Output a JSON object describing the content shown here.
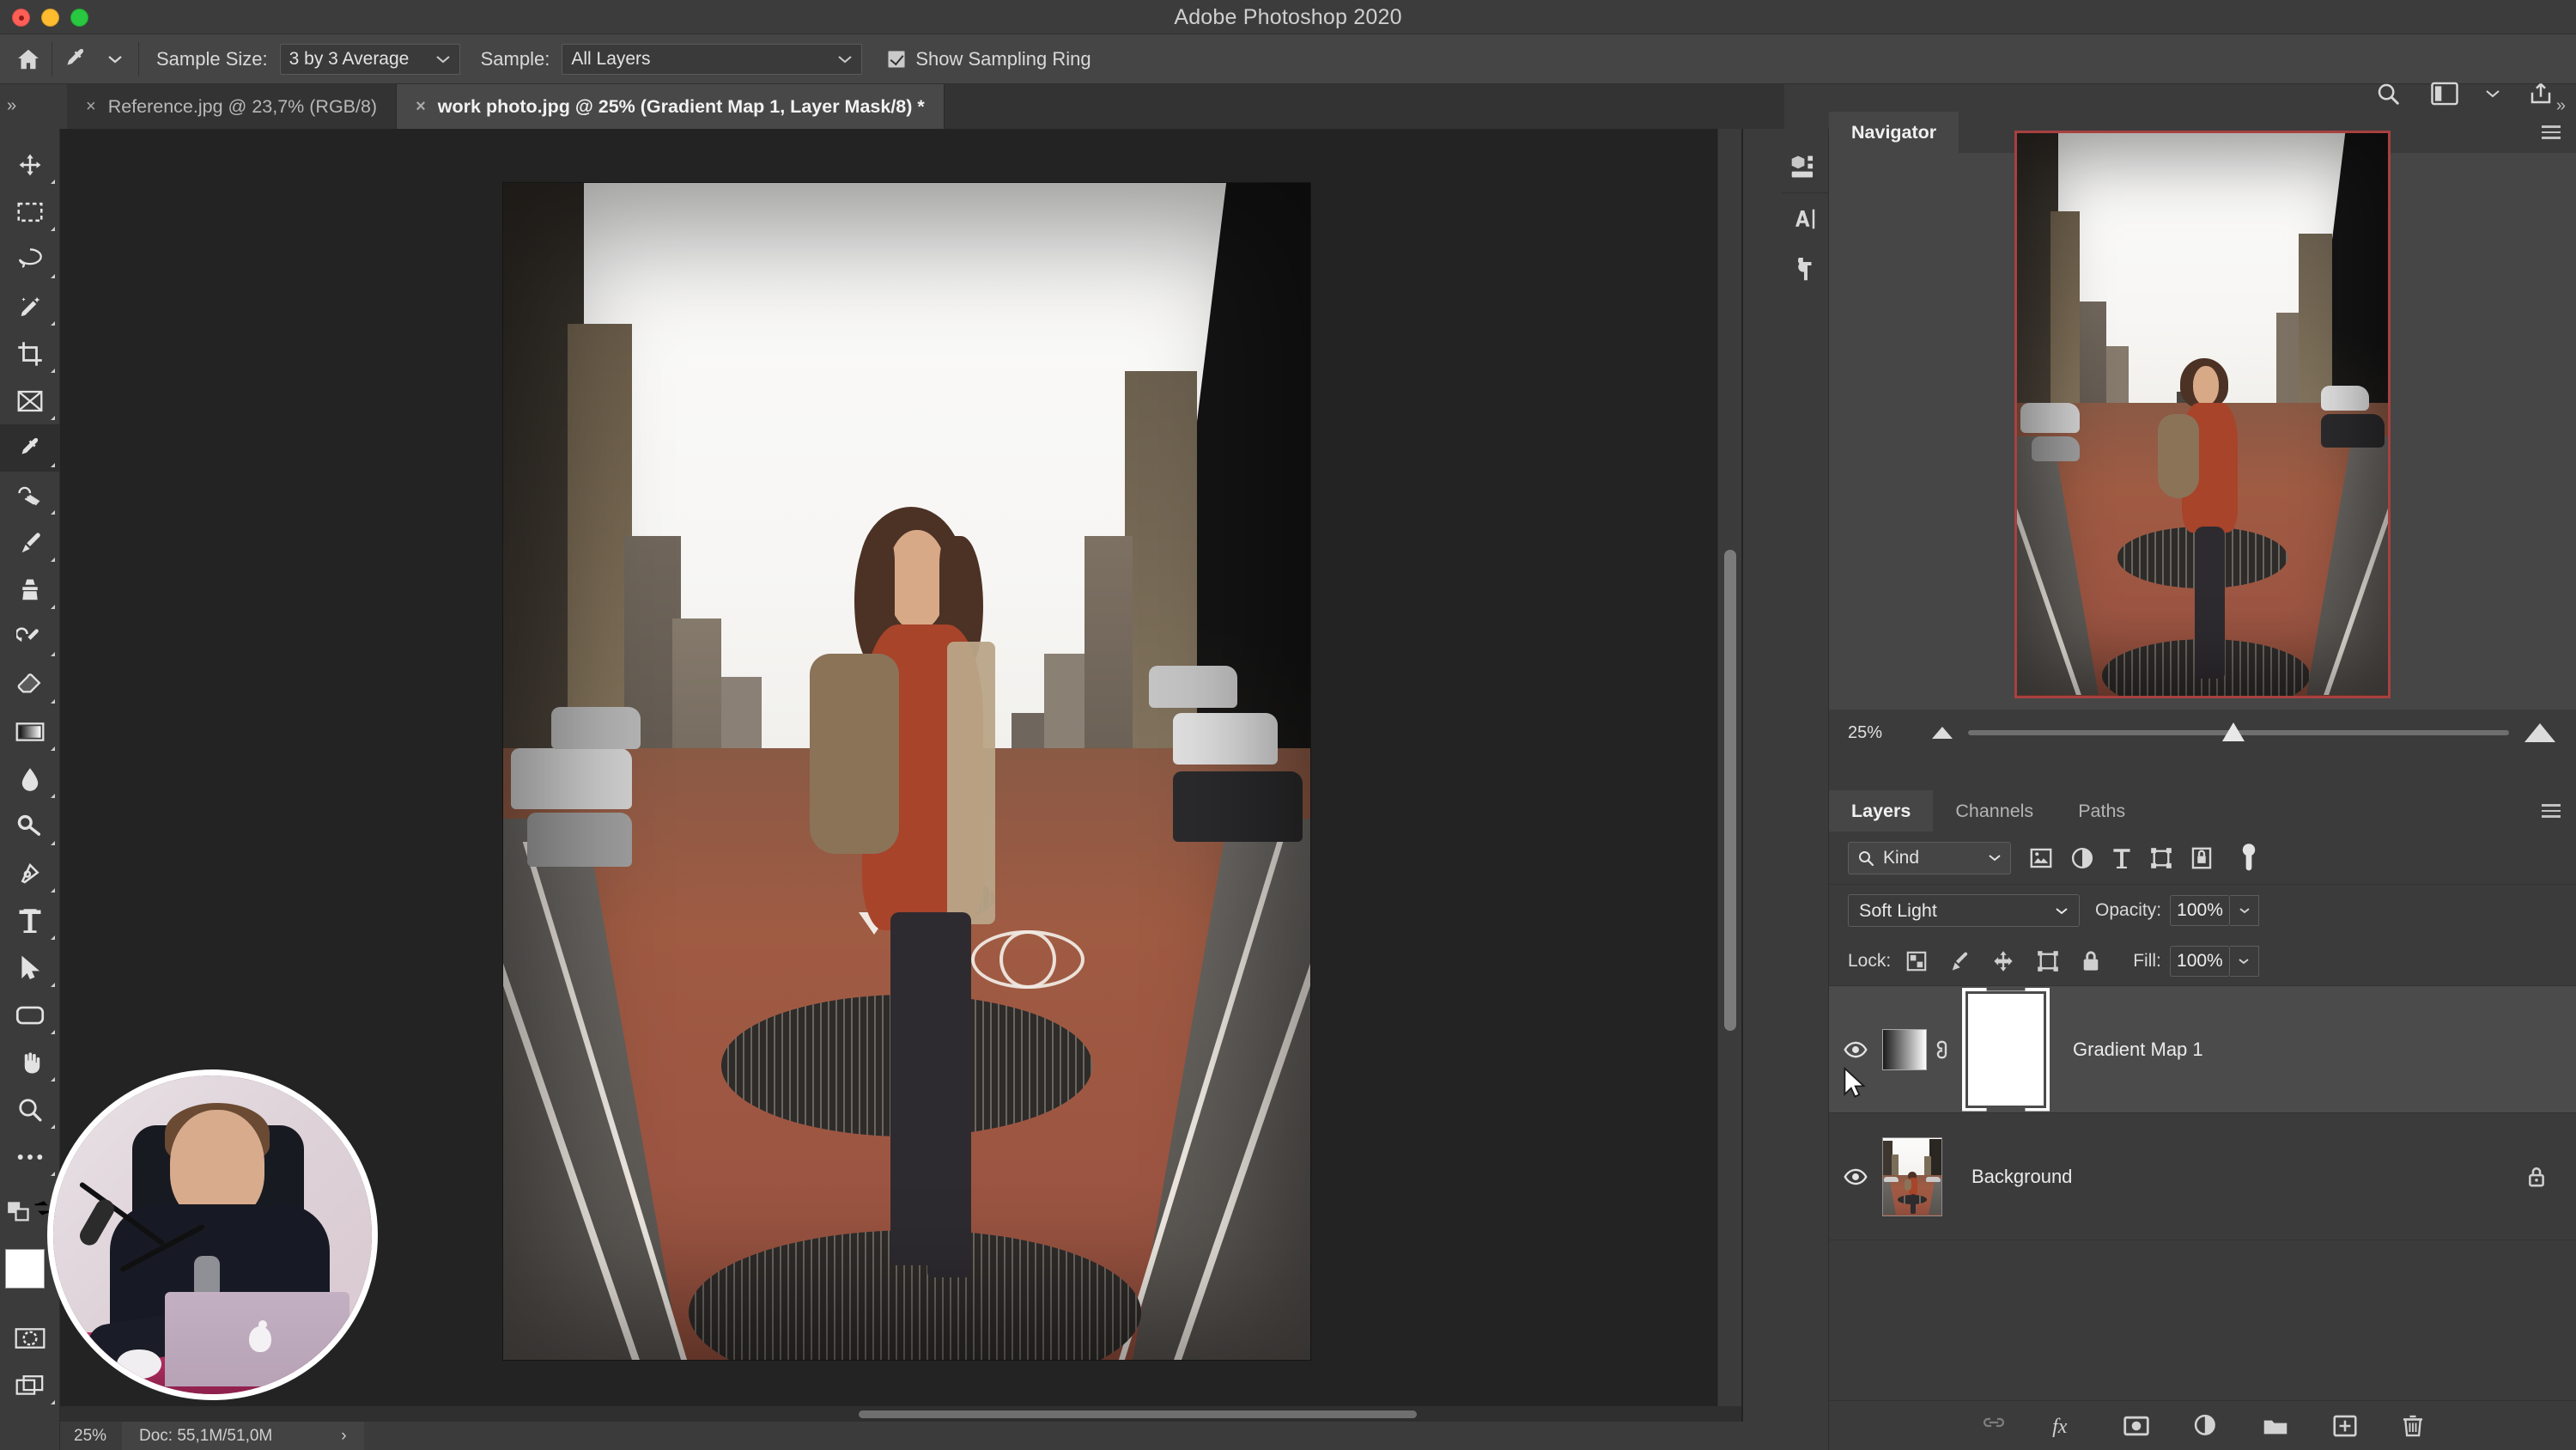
{
  "window": {
    "title": "Adobe Photoshop 2020",
    "traffic_lights": [
      "close-red",
      "minimize-yellow",
      "zoom-green"
    ]
  },
  "options_bar": {
    "home_icon": "home-icon",
    "tool_icon": "eyedropper-icon",
    "tool_preset_chevron": "chevron-down-icon",
    "sample_size_label": "Sample Size:",
    "sample_size_value": "3 by 3 Average",
    "sample_label": "Sample:",
    "sample_value": "All Layers",
    "show_sampling_ring_label": "Show Sampling Ring",
    "show_sampling_ring_checked": true,
    "right_icons": [
      "search-icon",
      "workspace-icon",
      "chevron-down-icon",
      "share-icon"
    ]
  },
  "tabs": [
    {
      "label": "Reference.jpg @ 23,7% (RGB/8)",
      "active": false,
      "close": "×"
    },
    {
      "label": "work photo.jpg @ 25% (Gradient Map 1, Layer Mask/8) *",
      "active": true,
      "close": "×"
    }
  ],
  "collapse": {
    "left": "»",
    "right": "»"
  },
  "toolbar": {
    "tools": [
      {
        "name": "move-tool",
        "active": false
      },
      {
        "name": "rectangular-marquee-tool",
        "active": false
      },
      {
        "name": "lasso-tool",
        "active": false
      },
      {
        "name": "object-selection-tool",
        "active": false
      },
      {
        "name": "crop-tool",
        "active": false
      },
      {
        "name": "frame-tool",
        "active": false
      },
      {
        "name": "eyedropper-tool",
        "active": true
      },
      {
        "name": "spot-healing-brush-tool",
        "active": false
      },
      {
        "name": "brush-tool",
        "active": false
      },
      {
        "name": "clone-stamp-tool",
        "active": false
      },
      {
        "name": "history-brush-tool",
        "active": false
      },
      {
        "name": "eraser-tool",
        "active": false
      },
      {
        "name": "gradient-tool",
        "active": false
      },
      {
        "name": "blur-tool",
        "active": false
      },
      {
        "name": "dodge-tool",
        "active": false
      },
      {
        "name": "pen-tool",
        "active": false
      },
      {
        "name": "type-tool",
        "active": false
      },
      {
        "name": "path-selection-tool",
        "active": false
      },
      {
        "name": "rectangle-tool",
        "active": false
      },
      {
        "name": "hand-tool",
        "active": false
      },
      {
        "name": "zoom-tool",
        "active": false
      },
      {
        "name": "edit-toolbar-tool",
        "active": false
      }
    ],
    "foreground_color": "#ffffff",
    "background_color": "#000000",
    "quick_mask_icon": "quick-mask-icon",
    "screen_mode_icon": "screen-mode-icon"
  },
  "canvas": {
    "document_name": "work photo.jpg",
    "scroll_vertical_present": true,
    "scroll_horizontal_present": true
  },
  "status_bar": {
    "zoom": "25%",
    "doc_label": "Doc: 55,1M/51,0M",
    "expand_chevron": "›"
  },
  "dock_strip": {
    "icons": [
      "3d-properties-icon",
      "character-icon",
      "paragraph-icon"
    ]
  },
  "navigator": {
    "tab_label": "Navigator",
    "menu_icon": "panel-menu-icon",
    "zoom_value": "25%",
    "zoom_out_icon": "small-mountain-icon",
    "zoom_in_icon": "large-mountain-icon",
    "slider_position_pct": 47,
    "view_box_color": "#a84040"
  },
  "layers_panel": {
    "tabs": [
      {
        "label": "Layers",
        "active": true
      },
      {
        "label": "Channels",
        "active": false
      },
      {
        "label": "Paths",
        "active": false
      }
    ],
    "menu_icon": "panel-menu-icon",
    "filter": {
      "kind_label": "Kind",
      "search_icon": "search-icon",
      "chevron": "chevron-down-icon",
      "type_filters": [
        "pixel-layer-icon",
        "adjustment-layer-icon",
        "type-layer-icon",
        "shape-layer-icon",
        "smart-object-icon"
      ],
      "toggle_icon": "filter-toggle-icon"
    },
    "blend_mode": "Soft Light",
    "blend_chevron": "chevron-down-icon",
    "opacity_label": "Opacity:",
    "opacity_value": "100%",
    "lock_label": "Lock:",
    "lock_icons": [
      "lock-transparent-pixels-icon",
      "lock-image-pixels-icon",
      "lock-position-icon",
      "lock-artboard-icon",
      "lock-all-icon"
    ],
    "fill_label": "Fill:",
    "fill_value": "100%",
    "layers": [
      {
        "name": "Gradient Map 1",
        "visible": true,
        "selected": true,
        "thumb_type": "gradient-map-thumbnail",
        "link_icon": "link-icon",
        "mask": "white-layer-mask",
        "mask_selected": true,
        "locked": false
      },
      {
        "name": "Background",
        "visible": true,
        "selected": false,
        "thumb_type": "photo-thumbnail",
        "locked": true,
        "lock_icon": "lock-icon"
      }
    ],
    "bottom_icons": [
      "link-layers-icon",
      "layer-style-fx-icon",
      "add-layer-mask-icon",
      "new-adjustment-layer-icon",
      "new-group-icon",
      "new-layer-icon",
      "delete-layer-icon"
    ]
  },
  "webcam_overlay": {
    "present": true,
    "description": "circular webcam feed"
  }
}
